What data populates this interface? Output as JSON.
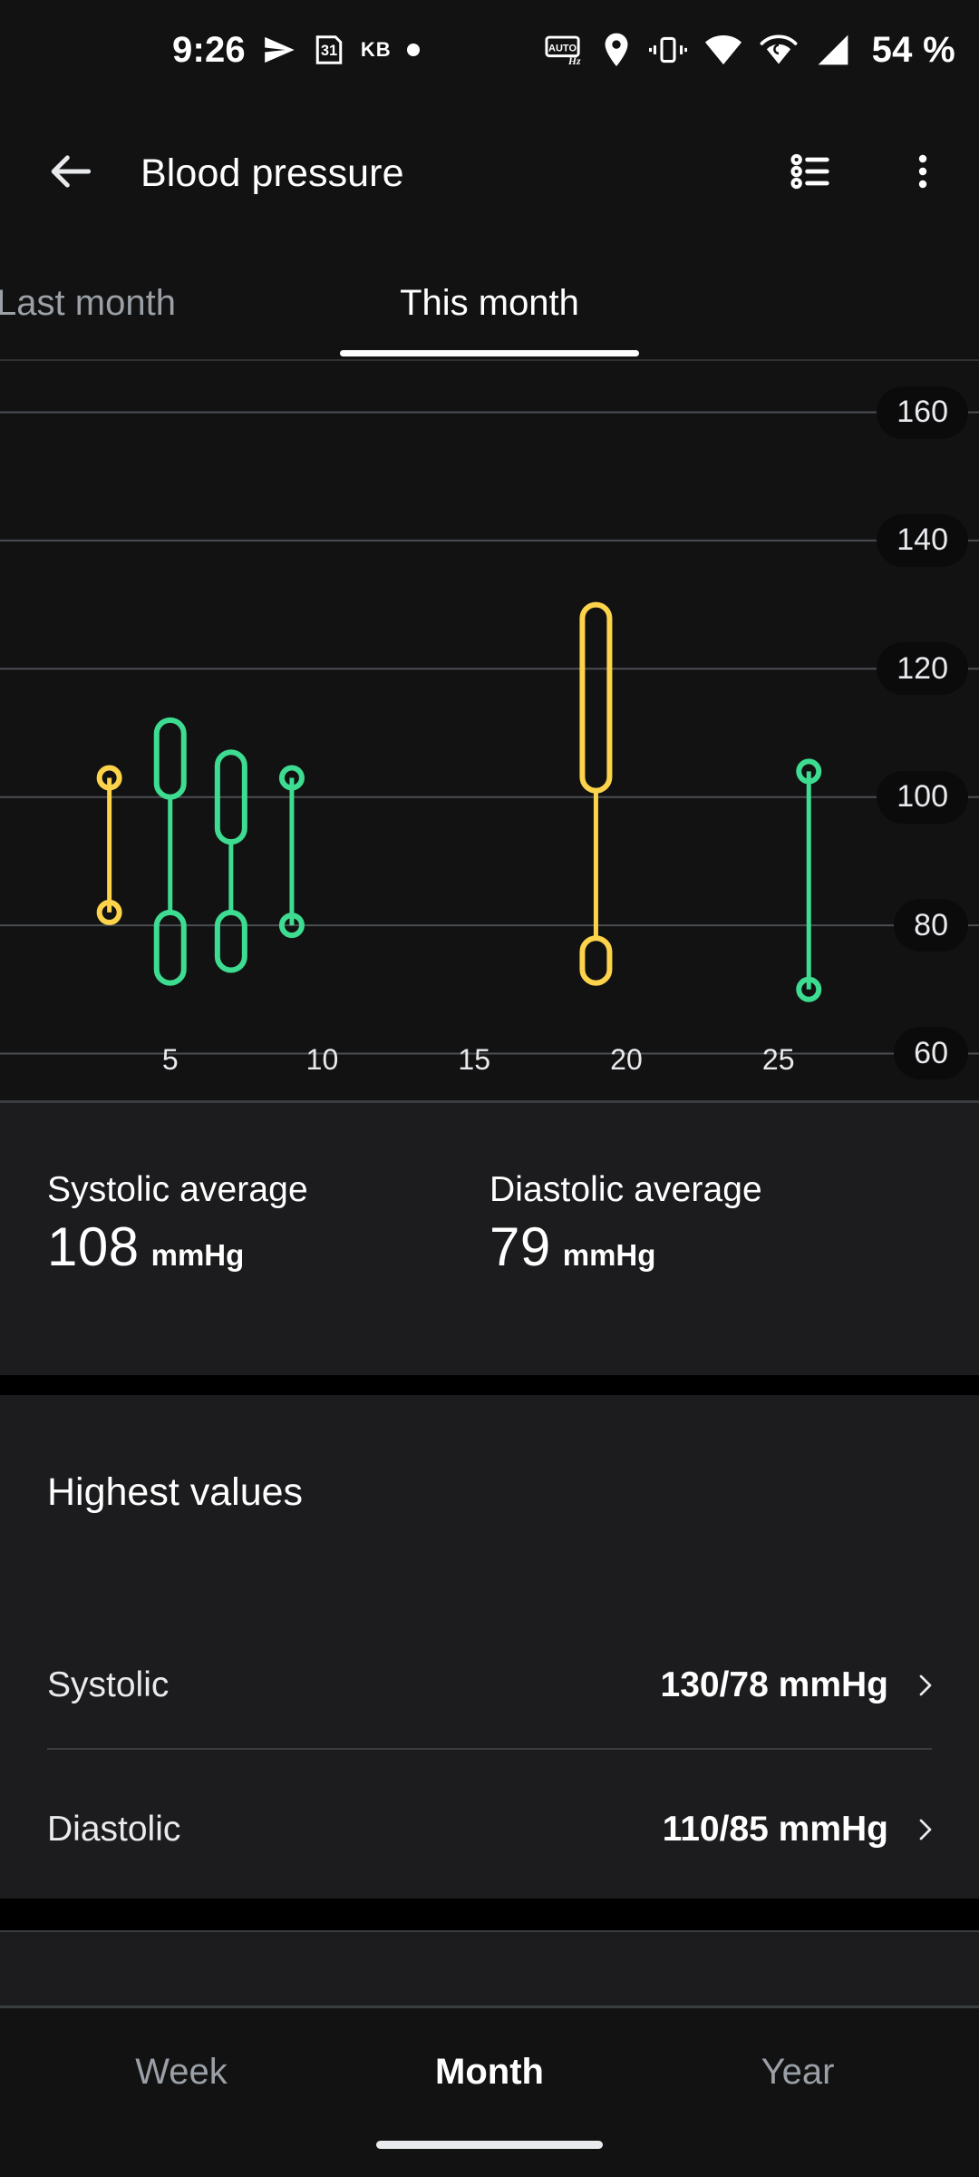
{
  "status_bar": {
    "time": "9:26",
    "battery": "54 %",
    "keyboard_label": "KB",
    "icons": [
      "telegram-send-icon",
      "calendar-31-icon",
      "keyboard-kb-icon",
      "dot-icon",
      "auto-hz-icon",
      "location-pin-icon",
      "vibrate-icon",
      "wifi-icon",
      "wifi-calling-icon",
      "cellular-signal-icon"
    ]
  },
  "app_bar": {
    "title": "Blood pressure",
    "back_icon": "arrow-back-icon",
    "list_icon": "list-view-icon",
    "overflow_icon": "more-vert-icon"
  },
  "period_tabs": {
    "items": [
      {
        "label": "Last month",
        "selected": false
      },
      {
        "label": "This month",
        "selected": true
      }
    ]
  },
  "chart_data": {
    "type": "bar",
    "title": "Blood pressure — This month",
    "subtitle": "",
    "xlabel": "",
    "ylabel": "mmHg",
    "grid": true,
    "legend": null,
    "ylim": [
      52,
      168
    ],
    "xlim": [
      0,
      31
    ],
    "y_ticks": [
      160,
      140,
      120,
      100,
      80,
      60
    ],
    "x_ticks": [
      5,
      10,
      15,
      20,
      25
    ],
    "colors": {
      "normal": "#3ddc91",
      "elevated": "#fcd34a"
    },
    "series": [
      {
        "name": "Systolic",
        "values": [
          103,
          105,
          100,
          103,
          125,
          104
        ]
      },
      {
        "name": "Diastolic",
        "values": [
          82,
          71,
          73,
          80,
          71,
          70
        ]
      }
    ],
    "points": [
      {
        "day": 3,
        "systolic_high": 103,
        "systolic_low": 103,
        "diastolic_high": 82,
        "diastolic_low": 82,
        "color": "#fcd34a",
        "sys_range": false,
        "dia_range": false
      },
      {
        "day": 5,
        "systolic_high": 112,
        "systolic_low": 100,
        "diastolic_high": 82,
        "diastolic_low": 71,
        "color": "#3ddc91",
        "sys_range": true,
        "dia_range": true
      },
      {
        "day": 7,
        "systolic_high": 107,
        "systolic_low": 93,
        "diastolic_high": 82,
        "diastolic_low": 73,
        "color": "#3ddc91",
        "sys_range": true,
        "dia_range": true
      },
      {
        "day": 9,
        "systolic_high": 103,
        "systolic_low": 103,
        "diastolic_high": 80,
        "diastolic_low": 80,
        "color": "#3ddc91",
        "sys_range": false,
        "dia_range": false
      },
      {
        "day": 19,
        "systolic_high": 130,
        "systolic_low": 101,
        "diastolic_high": 78,
        "diastolic_low": 71,
        "color": "#fcd34a",
        "sys_range": true,
        "dia_range": true
      },
      {
        "day": 26,
        "systolic_high": 104,
        "systolic_low": 104,
        "diastolic_high": 70,
        "diastolic_low": 70,
        "color": "#3ddc91",
        "sys_range": false,
        "dia_range": false
      }
    ]
  },
  "averages": [
    {
      "label": "Systolic average",
      "value": "108",
      "unit": "mmHg"
    },
    {
      "label": "Diastolic average",
      "value": "79",
      "unit": "mmHg"
    }
  ],
  "highest_values": {
    "title": "Highest values",
    "rows": [
      {
        "name": "Systolic",
        "value": "130/78 mmHg",
        "chevron": "chevron-right-icon"
      },
      {
        "name": "Diastolic",
        "value": "110/85 mmHg",
        "chevron": "chevron-right-icon"
      }
    ]
  },
  "bottom_nav": {
    "items": [
      {
        "label": "Week",
        "selected": false
      },
      {
        "label": "Month",
        "selected": true
      },
      {
        "label": "Year",
        "selected": false
      }
    ]
  }
}
